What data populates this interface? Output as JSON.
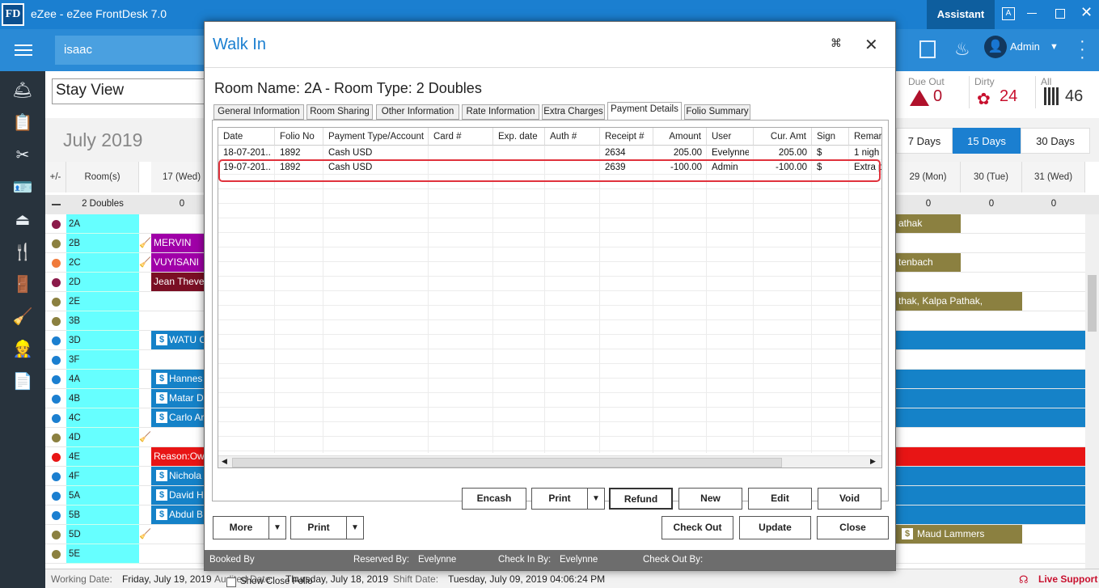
{
  "app": {
    "logo": "FD",
    "title": "eZee - eZee FrontDesk 7.0",
    "assistant": "Assistant",
    "user": "Admin",
    "search_value": "isaac"
  },
  "toolbar": {
    "view_select": "Stay View",
    "month": "July 2019"
  },
  "status": {
    "due_out_label": "Due Out",
    "due_out_value": "0",
    "dirty_label": "Dirty",
    "dirty_value": "24",
    "all_label": "All",
    "all_value": "46"
  },
  "range_buttons": [
    "7 Days",
    "15 Days",
    "30 Days"
  ],
  "grid": {
    "col_toggle": "+/-",
    "col_rooms": "Room(s)",
    "dates": [
      {
        "label": "17 (Wed)"
      },
      {
        "label": "29 (Mon)"
      },
      {
        "label": "30 (Tue)"
      },
      {
        "label": "31 (Wed)"
      }
    ],
    "group": {
      "name": "2 Doubles",
      "counts": [
        "0",
        "0",
        "0",
        "0"
      ]
    },
    "rooms": [
      "2A",
      "2B",
      "2C",
      "2D",
      "2E",
      "3B",
      "3D",
      "3F",
      "4A",
      "4B",
      "4C",
      "4D",
      "4E",
      "4F",
      "5A",
      "5B",
      "5D",
      "5E"
    ],
    "left_bookings": [
      "MERVIN",
      "VUYISANI",
      "Jean Theven",
      "WATU C",
      "Hannes",
      "Matar D",
      "Carlo Ar",
      "Reason:Owr",
      "Nichola",
      "David H",
      "Abdul B"
    ],
    "right_bookings": [
      "athak",
      "tenbach",
      "thak, Kalpa Pathak,",
      "Maud Lammers"
    ]
  },
  "statusbar": {
    "working_label": "Working Date:",
    "working_value": "Friday, July 19, 2019",
    "audited_label": "Audited Date:",
    "audited_value": "Thursday, July 18, 2019",
    "shift_label": "Shift Date:",
    "shift_value": "Tuesday, July 09, 2019 04:06:24 PM",
    "live_support": "Live Support"
  },
  "dialog": {
    "title": "Walk In",
    "headline": "Room Name: 2A - Room Type: 2 Doubles",
    "tabs": [
      "General Information",
      "Room Sharing",
      "Other Information",
      "Rate Information",
      "Extra Charges",
      "Payment Details",
      "Folio Summary"
    ],
    "active_tab": "Payment Details",
    "columns": [
      "Date",
      "Folio No",
      "Payment Type/Account",
      "Card #",
      "Exp. date",
      "Auth #",
      "Receipt #",
      "Amount",
      "User",
      "Cur. Amt",
      "Sign",
      "Remar"
    ],
    "rows": [
      [
        "18-07-201...",
        "1892",
        "Cash USD",
        "",
        "",
        "",
        "2634",
        "205.00",
        "Evelynne",
        "205.00",
        "$",
        "1 nigh"
      ],
      [
        "19-07-201...",
        "1892",
        "Cash USD",
        "",
        "",
        "",
        "2639",
        "-100.00",
        "Admin",
        "-100.00",
        "$",
        "Extra p"
      ]
    ],
    "show_close_folio": "Show Close Folio",
    "actions": {
      "encash": "Encash",
      "print": "Print",
      "refund": "Refund",
      "new": "New",
      "edit": "Edit",
      "void": "Void"
    },
    "bottom": {
      "more": "More",
      "print": "Print",
      "check_out": "Check Out",
      "update": "Update",
      "close": "Close"
    },
    "footer": {
      "booked_by": "Booked By",
      "reserved_by": "Reserved By:",
      "reserved_value": "Evelynne",
      "check_in_by": "Check In By:",
      "check_in_value": "Evelynne",
      "check_out_by": "Check Out By:"
    }
  }
}
